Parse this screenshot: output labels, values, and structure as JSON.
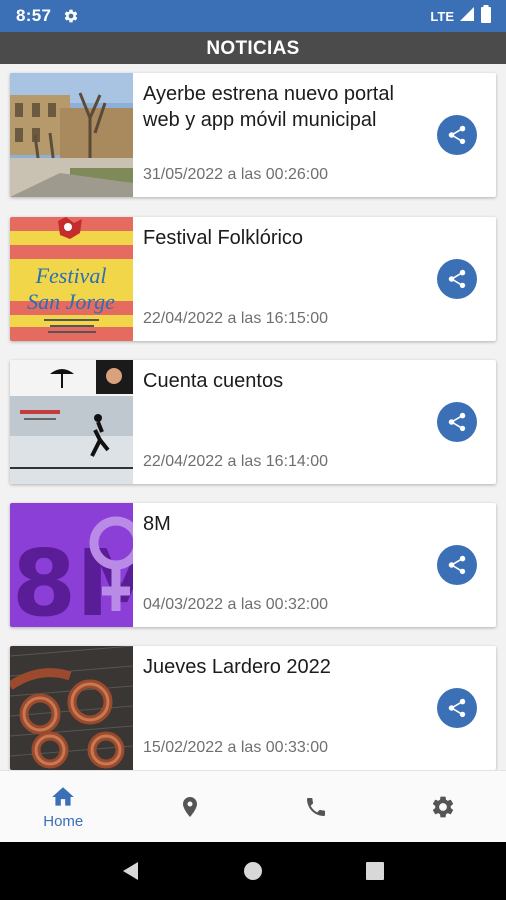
{
  "status_bar": {
    "time": "8:57",
    "network": "LTE"
  },
  "header": {
    "title": "NOTICIAS"
  },
  "news": [
    {
      "title": "Ayerbe estrena nuevo portal web y app móvil municipal",
      "date": "31/05/2022 a las 00:26:00"
    },
    {
      "title": "Festival Folklórico",
      "date": "22/04/2022 a las 16:15:00",
      "thumb_text_1": "Festival",
      "thumb_text_2": "San Jorge"
    },
    {
      "title": "Cuenta cuentos",
      "date": "22/04/2022 a las 16:14:00"
    },
    {
      "title": "8M",
      "date": "04/03/2022 a las 00:32:00",
      "thumb_text": "8M"
    },
    {
      "title": "Jueves Lardero 2022",
      "date": "15/02/2022 a las 00:33:00"
    }
  ],
  "bottom_nav": {
    "items": [
      {
        "icon": "home-icon",
        "label": "Home",
        "active": true
      },
      {
        "icon": "location-icon",
        "label": ""
      },
      {
        "icon": "phone-icon",
        "label": ""
      },
      {
        "icon": "settings-icon",
        "label": ""
      }
    ]
  },
  "colors": {
    "primary": "#3b6fb6",
    "header_bg": "#4b4b4b",
    "date_text": "#6f6f6f"
  }
}
